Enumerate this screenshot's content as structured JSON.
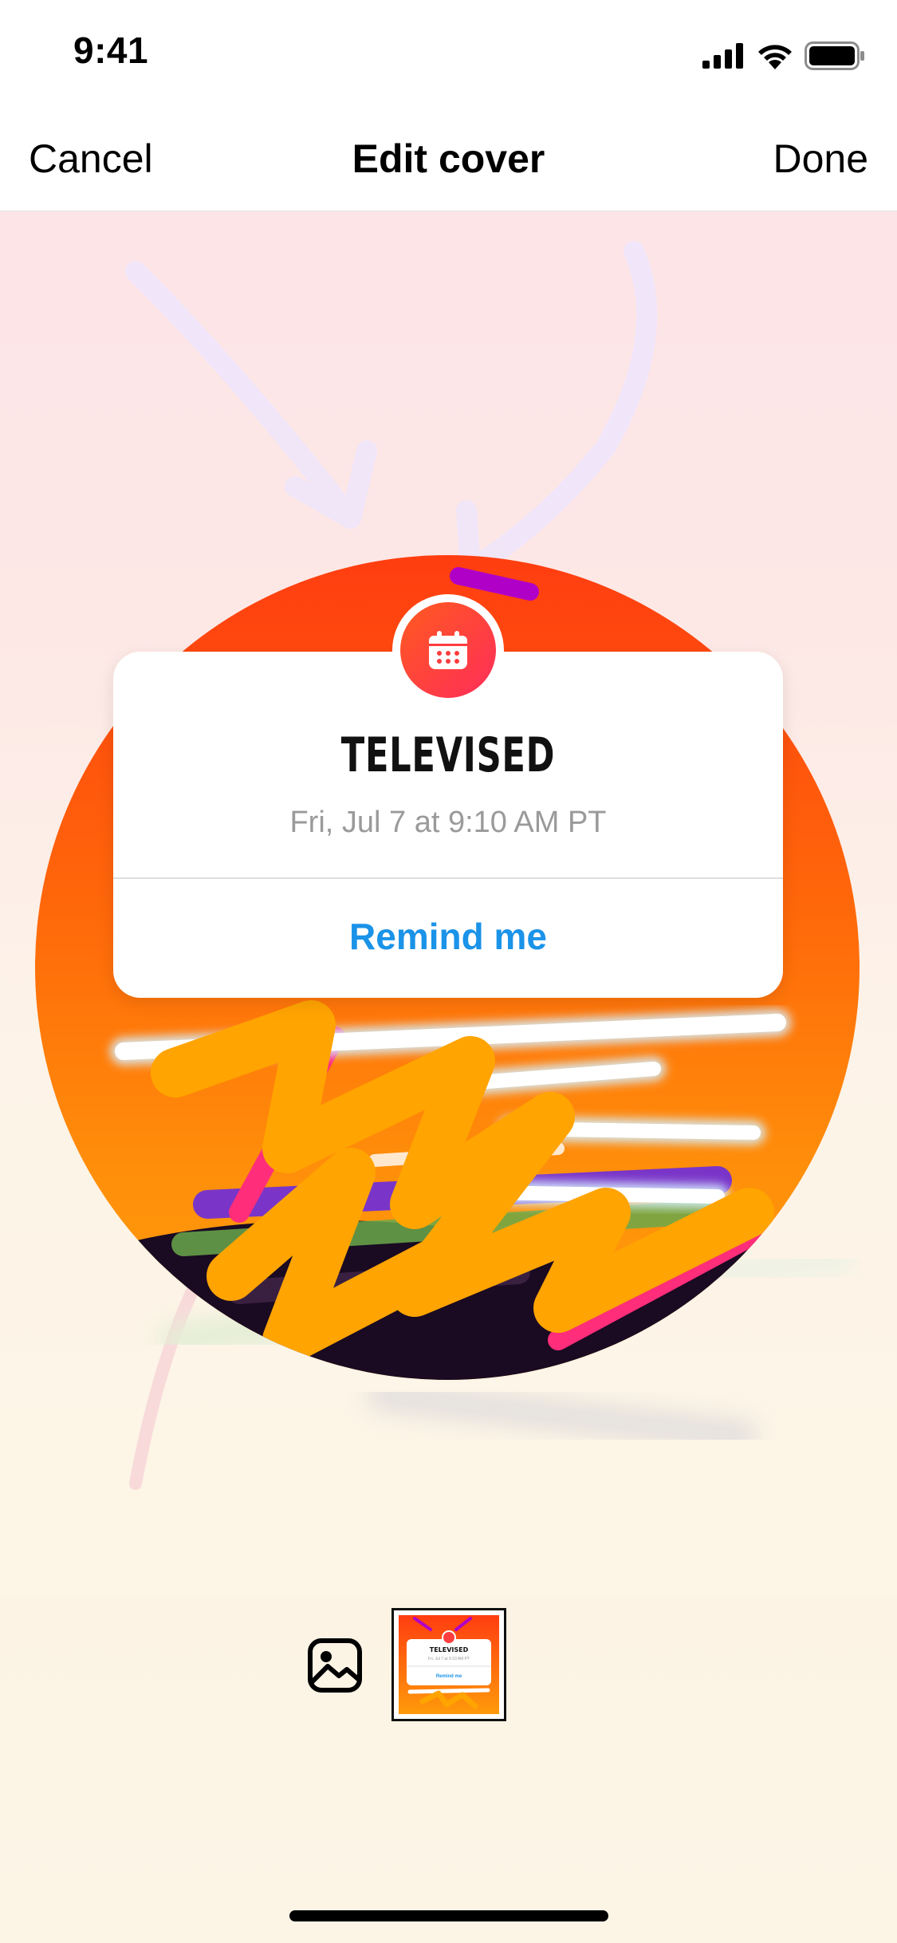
{
  "status_bar": {
    "time": "9:41"
  },
  "nav": {
    "cancel": "Cancel",
    "title": "Edit cover",
    "done": "Done"
  },
  "event_card": {
    "title": "TELEVISED",
    "date": "Fri, Jul 7 at 9:10 AM PT",
    "remind_label": "Remind me"
  },
  "thumbnail": {
    "title": "TELEVISED",
    "date": "Fri, Jul 7 at 9:10 AM PT",
    "remind_label": "Remind me"
  },
  "icons": {
    "signal": "cellular-signal-icon",
    "wifi": "wifi-icon",
    "battery": "battery-icon",
    "calendar": "calendar-icon",
    "gallery": "photo-gallery-icon"
  },
  "colors": {
    "accent_blue": "#1a93e8",
    "orange": "#ff7a00",
    "red_orange": "#ff4a12",
    "purple": "#b000c8"
  }
}
